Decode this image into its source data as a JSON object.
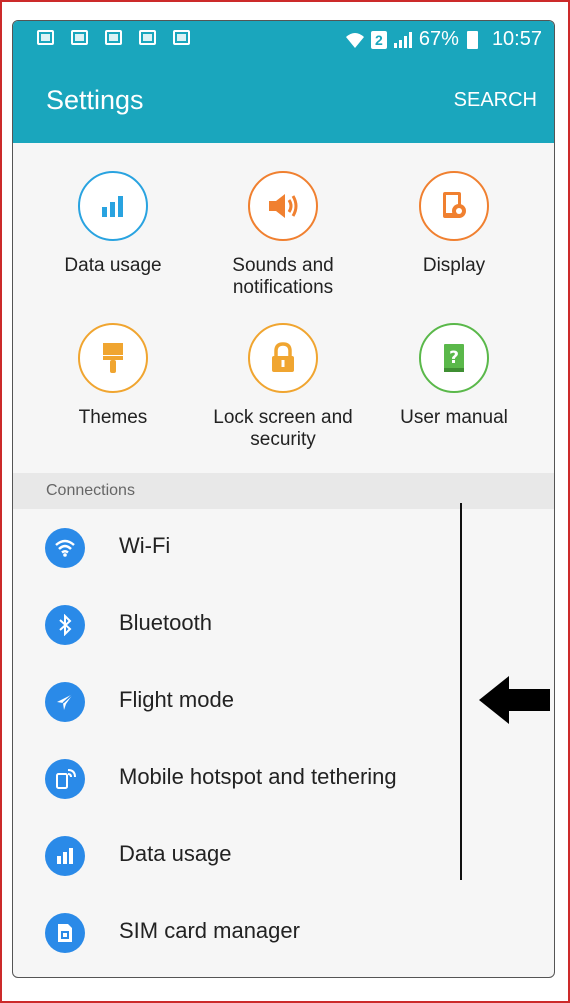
{
  "status_bar": {
    "signal_label": "2",
    "battery": "67%",
    "time": "10:57"
  },
  "app_bar": {
    "title": "Settings",
    "search_label": "SEARCH"
  },
  "quick_settings": [
    {
      "label": "Data usage",
      "icon": "data-usage-icon",
      "color": "#29a3e0"
    },
    {
      "label": "Sounds and notifications",
      "icon": "sound-icon",
      "color": "#f08030"
    },
    {
      "label": "Display",
      "icon": "display-icon",
      "color": "#f08030"
    },
    {
      "label": "Themes",
      "icon": "themes-icon",
      "color": "#f0a530"
    },
    {
      "label": "Lock screen and security",
      "icon": "lock-icon",
      "color": "#f0a530"
    },
    {
      "label": "User manual",
      "icon": "user-manual-icon",
      "color": "#5ab84a"
    }
  ],
  "section": {
    "title": "Connections"
  },
  "connections": [
    {
      "label": "Wi-Fi",
      "icon": "wifi-icon"
    },
    {
      "label": "Bluetooth",
      "icon": "bluetooth-icon"
    },
    {
      "label": "Flight mode",
      "icon": "flight-mode-icon"
    },
    {
      "label": "Mobile hotspot and tethering",
      "icon": "hotspot-icon"
    },
    {
      "label": "Data usage",
      "icon": "data-usage-icon"
    },
    {
      "label": "SIM card manager",
      "icon": "sim-card-icon"
    }
  ],
  "colors": {
    "accent": "#1aa6bd",
    "list_icon": "#2a8ae8"
  }
}
